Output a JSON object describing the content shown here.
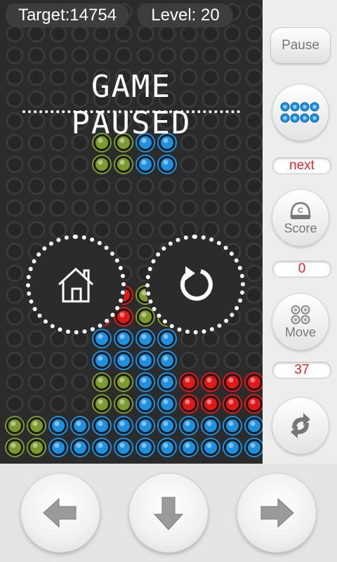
{
  "hud": {
    "target_text": "Target:14754",
    "level_text": "Level:  20"
  },
  "pause_overlay": {
    "title": "GAME PAUSED",
    "home_icon": "home-icon",
    "restart_icon": "restart-icon"
  },
  "sidebar": {
    "pause_label": "Pause",
    "next_label": "next",
    "score_label": "Score",
    "score_value": "0",
    "move_label": "Move",
    "move_value": "37",
    "icons": {
      "next_preview": "next-piece-preview-icon",
      "score": "score-cap-icon",
      "move": "move-dots-icon",
      "swap": "swap-arrows-icon"
    }
  },
  "controls": {
    "left_icon": "arrow-left-icon",
    "down_icon": "arrow-down-icon",
    "right_icon": "arrow-right-icon"
  },
  "colors": {
    "board": "#2b2b2b",
    "empty_cell": "#3a3a3a",
    "green": "#7d9a2e",
    "blue": "#1e90e0",
    "red": "#e01818",
    "counter_text": "#d62828"
  },
  "board": {
    "cols": 12,
    "rows": 21,
    "cells": [
      {
        "c": 4,
        "r": 6,
        "color": "green"
      },
      {
        "c": 5,
        "r": 6,
        "color": "green"
      },
      {
        "c": 4,
        "r": 7,
        "color": "green"
      },
      {
        "c": 5,
        "r": 7,
        "color": "green"
      },
      {
        "c": 6,
        "r": 6,
        "color": "blue"
      },
      {
        "c": 7,
        "r": 6,
        "color": "blue"
      },
      {
        "c": 6,
        "r": 7,
        "color": "blue"
      },
      {
        "c": 7,
        "r": 7,
        "color": "blue"
      },
      {
        "c": 4,
        "r": 13,
        "color": "red"
      },
      {
        "c": 5,
        "r": 13,
        "color": "red"
      },
      {
        "c": 4,
        "r": 14,
        "color": "red"
      },
      {
        "c": 5,
        "r": 14,
        "color": "red"
      },
      {
        "c": 6,
        "r": 13,
        "color": "green"
      },
      {
        "c": 7,
        "r": 13,
        "color": "green"
      },
      {
        "c": 6,
        "r": 14,
        "color": "green"
      },
      {
        "c": 7,
        "r": 14,
        "color": "green"
      },
      {
        "c": 4,
        "r": 15,
        "color": "blue"
      },
      {
        "c": 5,
        "r": 15,
        "color": "blue"
      },
      {
        "c": 6,
        "r": 15,
        "color": "blue"
      },
      {
        "c": 7,
        "r": 15,
        "color": "blue"
      },
      {
        "c": 4,
        "r": 16,
        "color": "blue"
      },
      {
        "c": 5,
        "r": 16,
        "color": "blue"
      },
      {
        "c": 6,
        "r": 16,
        "color": "blue"
      },
      {
        "c": 7,
        "r": 16,
        "color": "blue"
      },
      {
        "c": 4,
        "r": 17,
        "color": "green"
      },
      {
        "c": 5,
        "r": 17,
        "color": "green"
      },
      {
        "c": 6,
        "r": 17,
        "color": "blue"
      },
      {
        "c": 7,
        "r": 17,
        "color": "blue"
      },
      {
        "c": 8,
        "r": 17,
        "color": "red"
      },
      {
        "c": 9,
        "r": 17,
        "color": "red"
      },
      {
        "c": 10,
        "r": 17,
        "color": "red"
      },
      {
        "c": 11,
        "r": 17,
        "color": "red"
      },
      {
        "c": 4,
        "r": 18,
        "color": "green"
      },
      {
        "c": 5,
        "r": 18,
        "color": "green"
      },
      {
        "c": 6,
        "r": 18,
        "color": "blue"
      },
      {
        "c": 7,
        "r": 18,
        "color": "blue"
      },
      {
        "c": 8,
        "r": 18,
        "color": "red"
      },
      {
        "c": 9,
        "r": 18,
        "color": "red"
      },
      {
        "c": 10,
        "r": 18,
        "color": "red"
      },
      {
        "c": 11,
        "r": 18,
        "color": "red"
      },
      {
        "c": 0,
        "r": 19,
        "color": "green"
      },
      {
        "c": 1,
        "r": 19,
        "color": "green"
      },
      {
        "c": 2,
        "r": 19,
        "color": "blue"
      },
      {
        "c": 3,
        "r": 19,
        "color": "blue"
      },
      {
        "c": 4,
        "r": 19,
        "color": "blue"
      },
      {
        "c": 5,
        "r": 19,
        "color": "blue"
      },
      {
        "c": 6,
        "r": 19,
        "color": "blue"
      },
      {
        "c": 7,
        "r": 19,
        "color": "blue"
      },
      {
        "c": 8,
        "r": 19,
        "color": "blue"
      },
      {
        "c": 9,
        "r": 19,
        "color": "blue"
      },
      {
        "c": 10,
        "r": 19,
        "color": "blue"
      },
      {
        "c": 11,
        "r": 19,
        "color": "blue"
      },
      {
        "c": 0,
        "r": 20,
        "color": "green"
      },
      {
        "c": 1,
        "r": 20,
        "color": "green"
      },
      {
        "c": 2,
        "r": 20,
        "color": "blue"
      },
      {
        "c": 3,
        "r": 20,
        "color": "blue"
      },
      {
        "c": 4,
        "r": 20,
        "color": "blue"
      },
      {
        "c": 5,
        "r": 20,
        "color": "blue"
      },
      {
        "c": 6,
        "r": 20,
        "color": "blue"
      },
      {
        "c": 7,
        "r": 20,
        "color": "blue"
      },
      {
        "c": 8,
        "r": 20,
        "color": "blue"
      },
      {
        "c": 9,
        "r": 20,
        "color": "blue"
      },
      {
        "c": 10,
        "r": 20,
        "color": "blue"
      },
      {
        "c": 11,
        "r": 20,
        "color": "blue"
      }
    ]
  }
}
